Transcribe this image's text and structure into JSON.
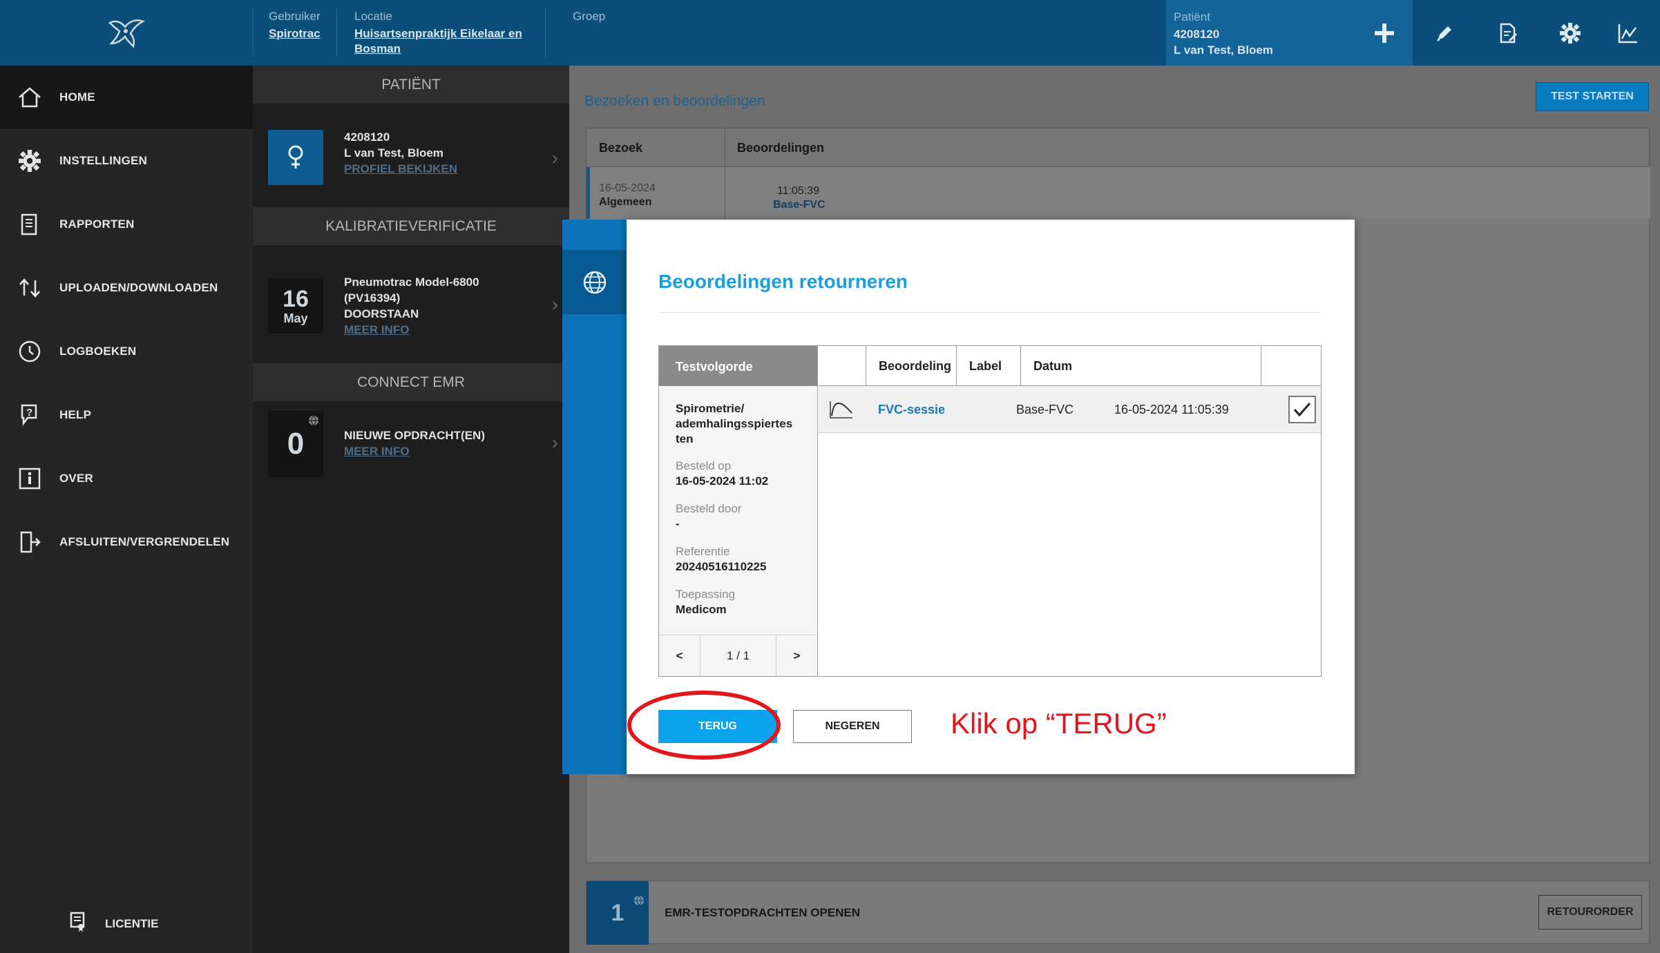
{
  "topbar": {
    "user_label": "Gebruiker",
    "user_value": "Spirotrac",
    "location_label": "Locatie",
    "location_line1": "Huisartsenpraktijk Eikelaar en",
    "location_line2": "Bosman",
    "group_label": "Groep",
    "patient_label": "Patiënt",
    "patient_id": "4208120",
    "patient_name": "L van Test, Bloem"
  },
  "sidebar": {
    "items": [
      {
        "label": "HOME",
        "icon": "home-icon"
      },
      {
        "label": "INSTELLINGEN",
        "icon": "gear-icon"
      },
      {
        "label": "RAPPORTEN",
        "icon": "report-icon"
      },
      {
        "label": "UPLOADEN/DOWNLOADEN",
        "icon": "upload-download-icon"
      },
      {
        "label": "LOGBOEKEN",
        "icon": "clock-icon"
      },
      {
        "label": "HELP",
        "icon": "help-icon"
      },
      {
        "label": "OVER",
        "icon": "info-icon"
      },
      {
        "label": "AFSLUITEN/VERGRENDELEN",
        "icon": "logout-icon"
      }
    ],
    "license": "LICENTIE"
  },
  "patient_col": {
    "patient_header": "PATIËNT",
    "patient_id": "4208120",
    "patient_name": "L van Test, Bloem",
    "profile_link": "PROFIEL BEKIJKEN",
    "calib_header": "KALIBRATIEVERIFICATIE",
    "calib_day": "16",
    "calib_month": "May",
    "calib_device": "Pneumotrac Model-6800",
    "calib_serial": "(PV16394)",
    "calib_status": "DOORSTAAN",
    "calib_link": "MEER INFO",
    "emr_header": "CONNECT EMR",
    "emr_count": "0",
    "emr_text": "NIEUWE OPDRACHT(EN)",
    "emr_link": "MEER INFO"
  },
  "main": {
    "title": "Bezoeken en beoordelingen",
    "start_button": "TEST STARTEN",
    "col_visit": "Bezoek",
    "col_assessments": "Beoordelingen",
    "visit_date": "16-05-2024",
    "visit_type": "Algemeen",
    "visit_time": "11:05:39",
    "visit_label": "Base-FVC",
    "emr_count": "1",
    "emr_text": "EMR-TESTOPDRACHTEN OPENEN",
    "return_button": "RETOURORDER"
  },
  "modal": {
    "title": "Beoordelingen retourneren",
    "left_header": "Testvolgorde",
    "test_name": "Spirometrie/ ademhalingsspiertes ten",
    "ordered_on_label": "Besteld op",
    "ordered_on_value": "16-05-2024 11:02",
    "ordered_by_label": "Besteld door",
    "ordered_by_value": "-",
    "reference_label": "Referentie",
    "reference_value": "20240516110225",
    "application_label": "Toepassing",
    "application_value": "Medicom",
    "page": "1 / 1",
    "prev": "<",
    "next": ">",
    "columns": [
      "Beoordeling",
      "Label",
      "Datum"
    ],
    "rows": [
      {
        "assessment": "FVC-sessie",
        "label": "Base-FVC",
        "date": "16-05-2024 11:05:39",
        "checked": true
      }
    ],
    "back_button": "TERUG",
    "ignore_button": "NEGEREN"
  },
  "annotation": {
    "text": "Klik op “TERUG”",
    "color": "#e3161c"
  }
}
